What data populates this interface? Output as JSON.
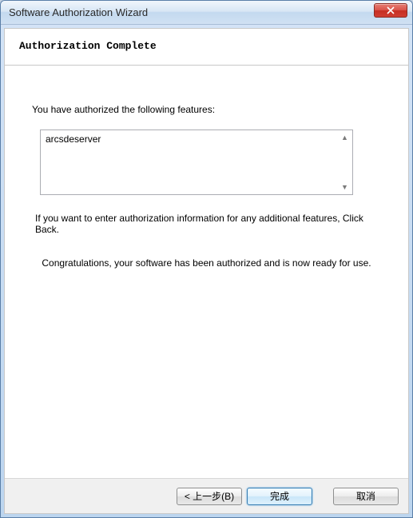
{
  "window": {
    "title": "Software Authorization Wizard"
  },
  "header": {
    "heading": "Authorization Complete"
  },
  "content": {
    "lead": "You have authorized the following features:",
    "features": [
      "arcsdeserver"
    ],
    "back_hint": "If you want to enter authorization information for any additional features, Click Back.",
    "congrats": "Congratulations, your software has been authorized and is now ready for use."
  },
  "buttons": {
    "back": "< 上一步(B)",
    "finish": "完成",
    "cancel": "取消"
  }
}
